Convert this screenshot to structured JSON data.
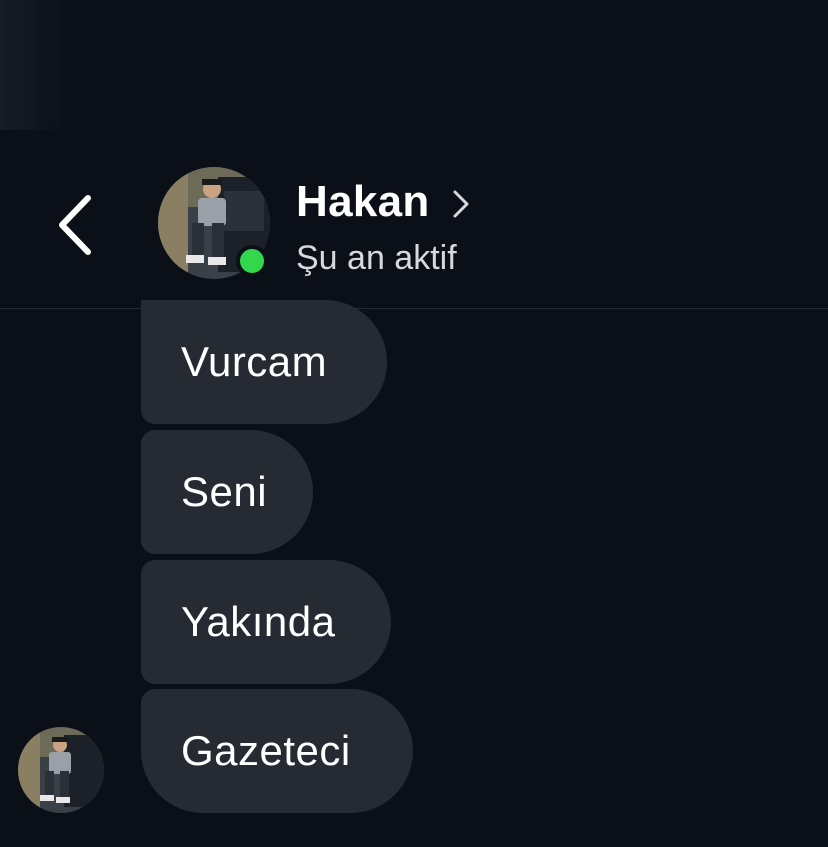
{
  "header": {
    "contact_name": "Hakan",
    "status": "Şu an aktif",
    "online_color": "#32d74b",
    "back_icon": "chevron-left-icon",
    "profile_icon": "chevron-right-icon"
  },
  "messages": [
    {
      "text": "Vurcam"
    },
    {
      "text": "Seni"
    },
    {
      "text": "Yakında"
    },
    {
      "text": "Gazeteci"
    }
  ],
  "colors": {
    "background": "#0b0f17",
    "bubble": "#262b33",
    "text": "#ffffff"
  }
}
